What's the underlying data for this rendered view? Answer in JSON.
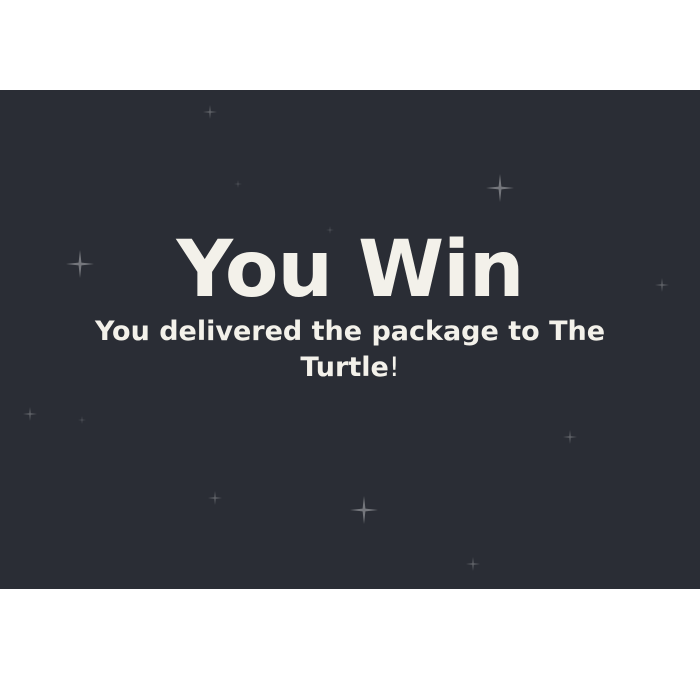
{
  "screen": {
    "title": "You Win",
    "message": "You delivered the package to The Turtle",
    "message_suffix": "!"
  },
  "colors": {
    "background": "#2a2d35",
    "text": "#f3f1ea",
    "page": "#ffffff"
  },
  "icons": {
    "decoration": "sparkle-star-icon"
  }
}
